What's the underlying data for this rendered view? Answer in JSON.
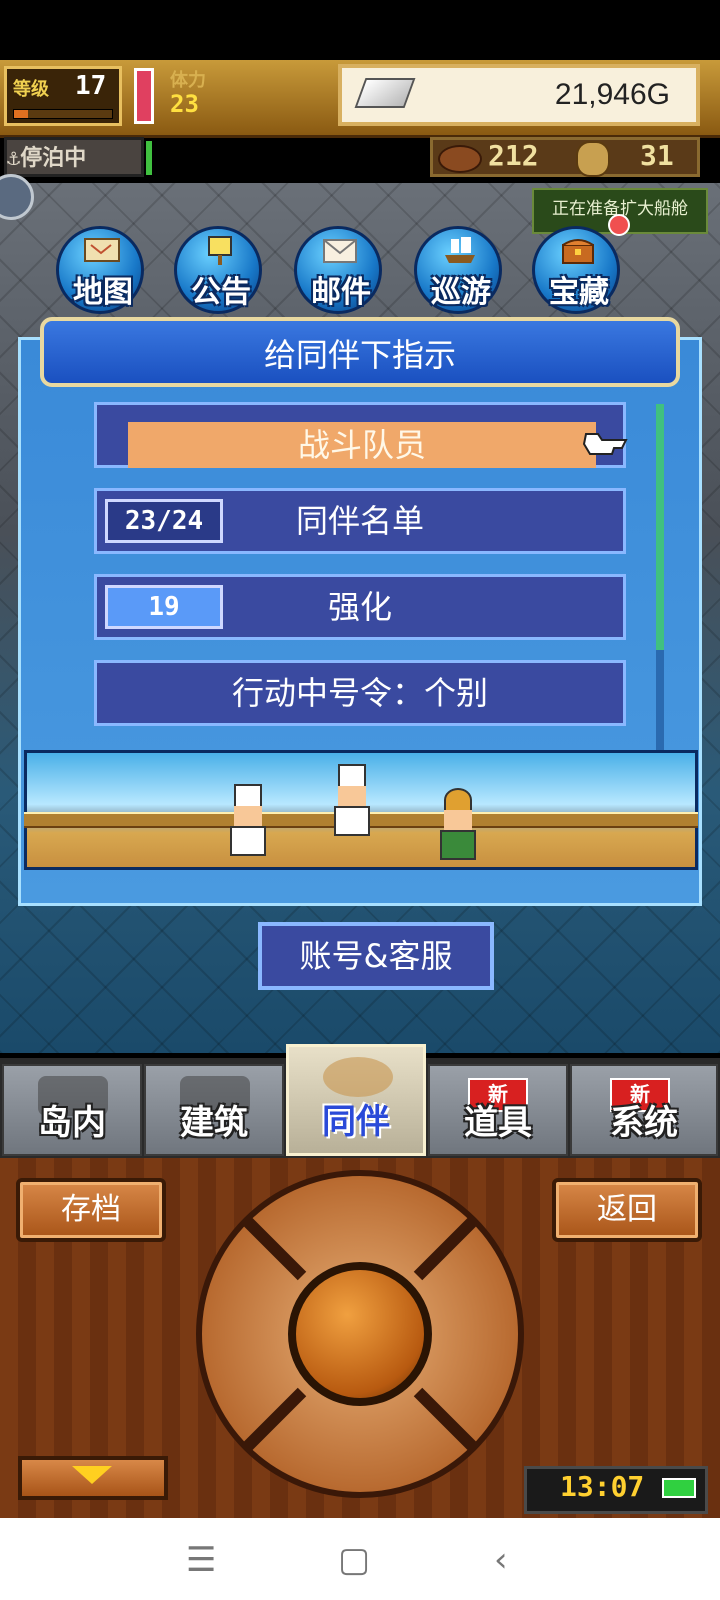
{
  "hud": {
    "level_label": "等级",
    "level_value": "17",
    "level_progress": 0.14,
    "stamina_label": "体力",
    "stamina_value": "23",
    "gold_value": "21,946G",
    "anchor_status": "停泊中",
    "wood_value": "212",
    "coin_value": "31"
  },
  "notice": "正在准备扩大船舱",
  "round_menu": [
    {
      "label": "地图",
      "icon": "map-icon"
    },
    {
      "label": "公告",
      "icon": "notice-board-icon"
    },
    {
      "label": "邮件",
      "icon": "mail-icon"
    },
    {
      "label": "巡游",
      "icon": "ship-icon"
    },
    {
      "label": "宝藏",
      "icon": "treasure-chest-icon"
    }
  ],
  "dialog": {
    "title": "给同伴下指示",
    "options": [
      {
        "label": "战斗队员",
        "selected": true
      },
      {
        "label": "同伴名单",
        "badge": "23/24"
      },
      {
        "label": "强化",
        "badge": "19"
      },
      {
        "label": "行动中号令：个别"
      }
    ]
  },
  "account_button": "账号&客服",
  "tabs": [
    {
      "label": "岛内",
      "new": false
    },
    {
      "label": "建筑",
      "new": false
    },
    {
      "label": "同伴",
      "new": false,
      "active": true
    },
    {
      "label": "道具",
      "new": true
    },
    {
      "label": "系统",
      "new": true
    }
  ],
  "new_badge": "新",
  "controller": {
    "save_label": "存档",
    "back_label": "返回"
  },
  "clock": "13:07",
  "colors": {
    "dialog_bg": "#3a8ad8",
    "row_bg": "#3a4aa0",
    "selected_row": "#f0a86a",
    "wood": "#7a3a14"
  }
}
